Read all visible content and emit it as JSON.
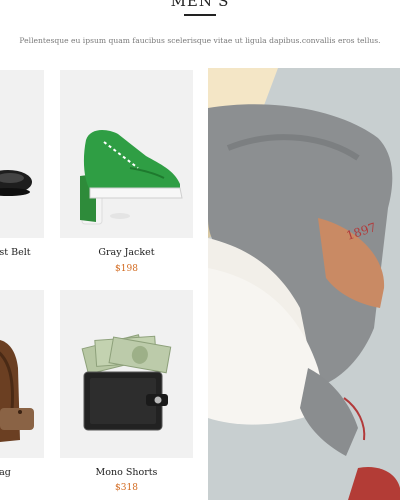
{
  "section": {
    "title": "MEN'S",
    "subtitle": "Pellentesque eu ipsum quam faucibus scelerisque vitae ut ligula dapibus.convallis eros tellus."
  },
  "products": [
    {
      "name": "st Belt",
      "price": ""
    },
    {
      "name": "Gray Jacket",
      "price": "$198"
    },
    {
      "name": "ag",
      "price": ""
    },
    {
      "name": "Mono Shorts",
      "price": "$318"
    }
  ],
  "hero": {
    "patch_text": "1897"
  },
  "colors": {
    "price": "#d2691e",
    "card_bg": "#f1f1f1",
    "title": "#222222"
  }
}
